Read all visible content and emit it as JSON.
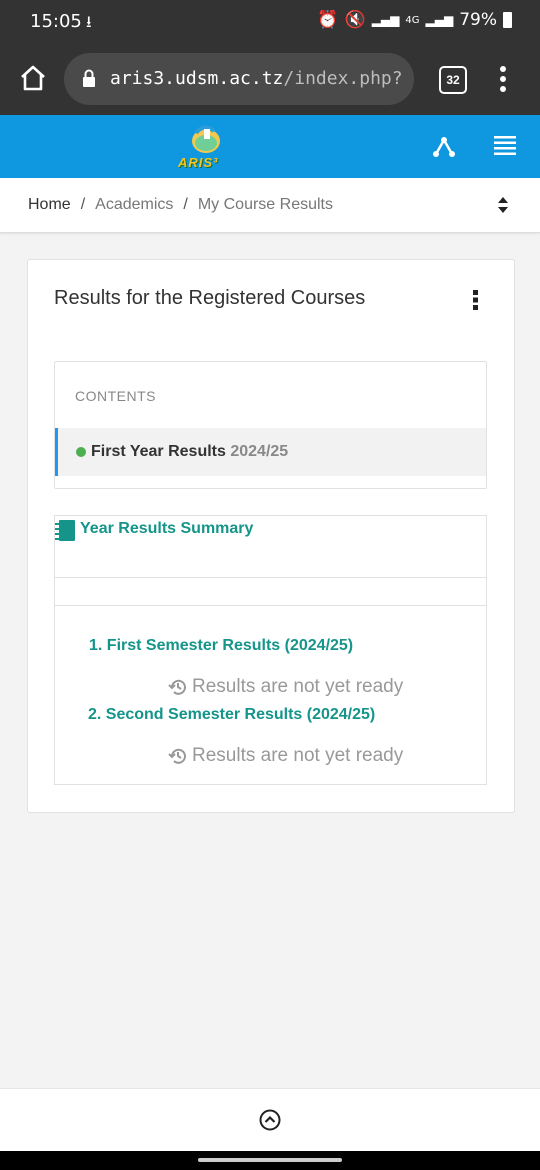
{
  "status_bar": {
    "time": "15:05",
    "battery": "79%",
    "network": "4G",
    "icons": [
      "download-icon",
      "alarm-icon",
      "mute-icon",
      "signal-icon",
      "battery-icon"
    ]
  },
  "browser": {
    "url_host": "aris3.udsm.ac.tz",
    "url_path": "/index.php?r=stu",
    "tab_count": "32",
    "icons": [
      "home-icon",
      "lock-icon",
      "overflow-menu-icon"
    ]
  },
  "app_header": {
    "logo_text": "ARIS³",
    "brand_color": "#0f98e0",
    "icons": [
      "share-icon",
      "list-menu-icon"
    ]
  },
  "breadcrumb": {
    "items": [
      "Home",
      "Academics",
      "My Course Results"
    ],
    "separator": "/"
  },
  "card": {
    "title": "Results for the Registered Courses",
    "contents": {
      "heading": "CONTENTS",
      "item_label": "First Year Results",
      "item_year": "2024/25",
      "status_color": "#4caf50"
    },
    "summary": {
      "title": "Year Results Summary",
      "accent_color": "#15958a",
      "semesters": [
        {
          "label": "1. First Semester Results (2024/25)",
          "status": "Results are not yet ready"
        },
        {
          "label": "2. Second Semester Results (2024/25)",
          "status": "Results are not yet ready"
        }
      ]
    }
  }
}
